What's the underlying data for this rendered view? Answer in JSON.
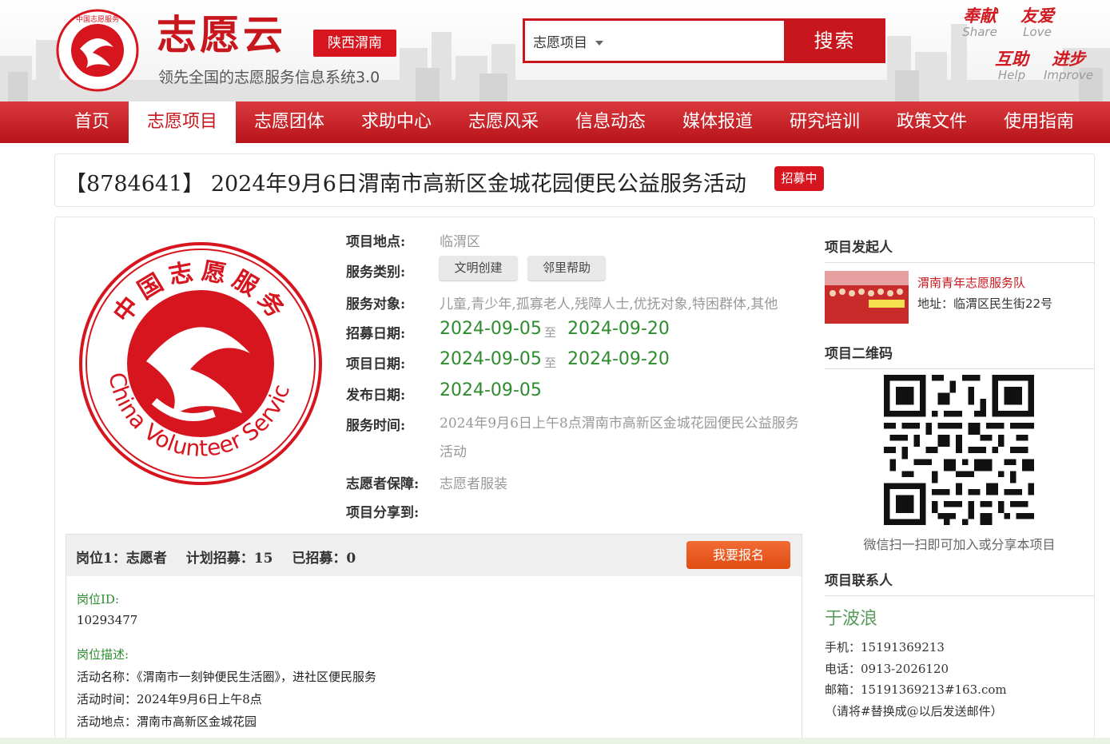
{
  "header": {
    "logo_text": "中国志愿服务",
    "brand": "志愿云",
    "region": "陕西渭南",
    "slogan": "领先全国的志愿服务信息系统3.0",
    "search": {
      "category": "志愿项目",
      "button": "搜索",
      "placeholder": ""
    },
    "mottos": [
      {
        "cn": "奉献",
        "en": "Share"
      },
      {
        "cn": "友爱",
        "en": "Love"
      },
      {
        "cn": "互助",
        "en": "Help"
      },
      {
        "cn": "进步",
        "en": "Improve"
      }
    ]
  },
  "nav": [
    "首页",
    "志愿项目",
    "志愿团体",
    "求助中心",
    "志愿风采",
    "信息动态",
    "媒体报道",
    "研究培训",
    "政策文件",
    "使用指南"
  ],
  "nav_active": "志愿项目",
  "project": {
    "id_title": "【8784641】 2024年9月6日渭南市高新区金城花园便民公益服务活动",
    "status": "招募中",
    "labels": {
      "location": "项目地点:",
      "category": "服务类别:",
      "target": "服务对象:",
      "recruit_date": "招募日期:",
      "project_date": "项目日期:",
      "publish_date": "发布日期:",
      "service_time": "服务时间:",
      "guarantee": "志愿者保障:",
      "share": "项目分享到:"
    },
    "location": "临渭区",
    "categories": [
      "文明创建",
      "邻里帮助"
    ],
    "target": "儿童,青少年,孤寡老人,残障人士,优抚对象,特困群体,其他",
    "recruit_start": "2024-09-05",
    "recruit_end": "2024-09-20",
    "project_start": "2024-09-05",
    "project_end": "2024-09-20",
    "to_word": "至",
    "publish_date": "2024-09-05",
    "service_time": "2024年9月6日上午8点渭南市高新区金城花园便民公益服务活动",
    "guarantee": "志愿者服装",
    "emblem_text_cn": "中国志愿服务",
    "emblem_text_en": "China Volunteer Service"
  },
  "position": {
    "name": "岗位1：志愿者",
    "plan": "计划招募：15",
    "enrolled": "已招募：0",
    "signup": "我要报名",
    "id_label": "岗位ID:",
    "id_value": "10293477",
    "desc_label": "岗位描述:",
    "desc_lines": [
      "活动名称：《渭南市一刻钟便民生活圈》，进社区便民服务",
      "活动时间：2024年9月6日上午8点",
      "活动地点：渭南市高新区金城花园"
    ]
  },
  "sidebar": {
    "initiator_head": "项目发起人",
    "org_name": "渭南青年志愿服务队",
    "org_address": "地址：临渭区民生街22号",
    "qr_head": "项目二维码",
    "qr_caption": "微信扫一扫即可加入或分享本项目",
    "contact_head": "项目联系人",
    "contact_name": "于波浪",
    "mobile": "手机：15191369213",
    "phone": "电话：0913-2026120",
    "email": "邮箱：15191369213#163.com",
    "email_note": "（请将#替换成@以后发送邮件）"
  },
  "colors": {
    "brand_red": "#c8161d",
    "green": "#2e8b2e",
    "orange": "#e8561a"
  }
}
